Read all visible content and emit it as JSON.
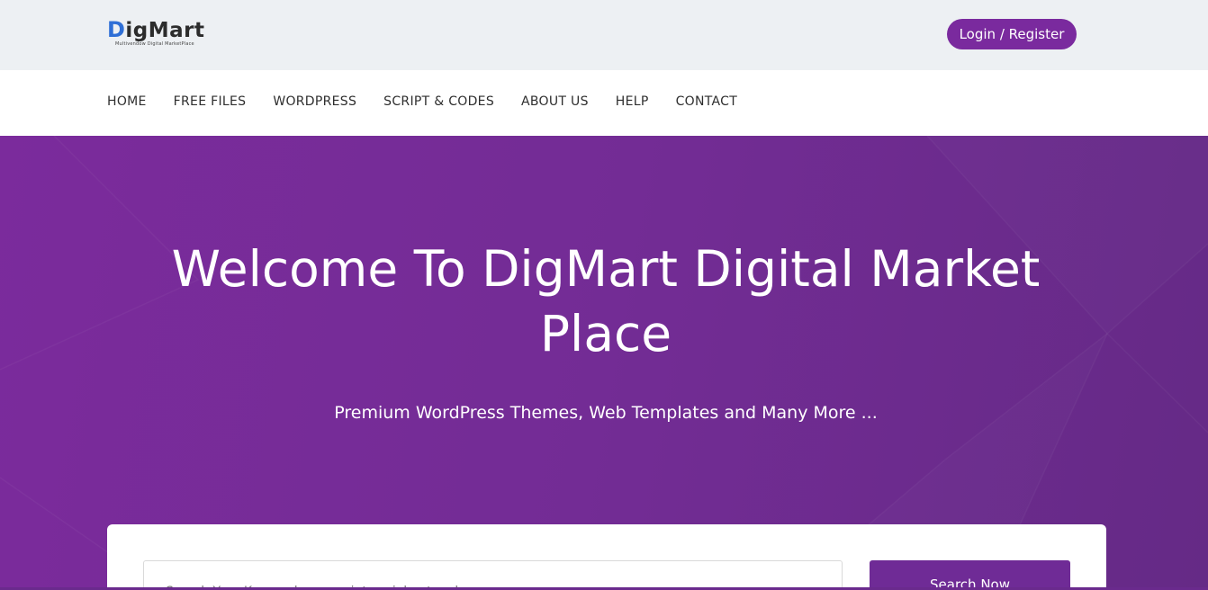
{
  "header": {
    "logo": {
      "text_first": "D",
      "text_rest": "igMart",
      "tagline": "Multivendow Digital MarketPlace"
    },
    "login_label": "Login / Register"
  },
  "nav": {
    "items": [
      {
        "label": "HOME"
      },
      {
        "label": "FREE FILES"
      },
      {
        "label": "WORDPRESS"
      },
      {
        "label": "SCRIPT & CODES"
      },
      {
        "label": "ABOUT US"
      },
      {
        "label": "HELP"
      },
      {
        "label": "CONTACT"
      }
    ]
  },
  "hero": {
    "title": "Welcome To DigMart Digital Market Place",
    "subtitle": "Premium WordPress Themes, Web Templates and Many More ..."
  },
  "search": {
    "placeholder": "Search Your Keywords e.g script,social networks...",
    "button_label": "Search Now"
  },
  "colors": {
    "brand_purple": "#7a2a9e",
    "hero_bg": "#732c95",
    "topbar_bg": "#edf0f3",
    "logo_blue": "#2f6fd6"
  }
}
